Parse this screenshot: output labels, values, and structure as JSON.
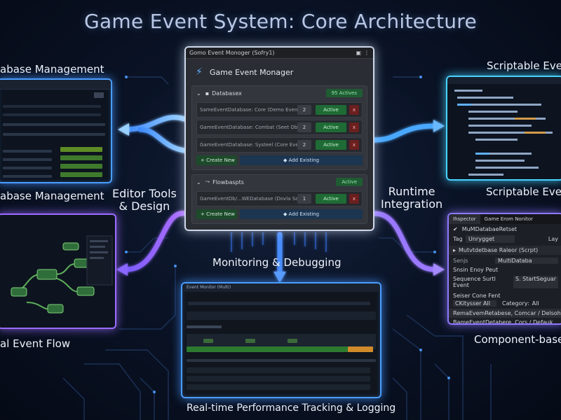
{
  "title": "Game Event System: Core Architecture",
  "labels": {
    "top_left": "abase Management",
    "mid_left": "abase Management",
    "bottom_left": "al Event Flow",
    "top_right": "Scriptable Event",
    "mid_right": "Scriptable Event",
    "bottom_right": "Component-based",
    "editor_tools": "Editor Tools\n& Design",
    "runtime": "Runtime\nIntegration",
    "monitoring": "Monitoring & Debugging",
    "performance": "Real-time Performance Tracking & Logging"
  },
  "window": {
    "titlebar": "Gomo Event Monoger (Sofry1)",
    "heading": "Game Event Monager",
    "section1": {
      "title": "Databasex",
      "badge": "95 Actives",
      "rows": [
        {
          "text": "SameEventDatabase: Core (Demo Event Deat...",
          "num": "2",
          "state": "Active"
        },
        {
          "text": "GameEventDatabase: Combat (Seet Ob/...",
          "num": "2",
          "state": "Active"
        },
        {
          "text": "GameEventDatabase: Systeel (Core Event De...",
          "num": "2",
          "state": "Active"
        }
      ],
      "create": "Create New",
      "add": "Add Existing"
    },
    "section2": {
      "title": "Flowbaspts",
      "badge": "Active",
      "rows": [
        {
          "text": "GameEventDb/...WEDatabase (Dovla Saue 11 D",
          "num": "1",
          "state": "Active"
        }
      ],
      "create": "Create New",
      "add": "Add Existing"
    }
  },
  "inspector": {
    "tab1": "Ihspector",
    "tab2": "Game Erom Nonitor",
    "object": "MuMDatabaeRetset",
    "tag_label": "Tag",
    "tag_value": "Unrygget",
    "layer_label": "Lay",
    "component": "Mutvtdetbase Raleor (Scrpt)",
    "script_label": "Senjs",
    "script_value": "MultiDataba",
    "event_label": "Snsin Enoy Peut",
    "sequence": "Sequence Surtl Event",
    "start_seq": "S. StartSeguar",
    "select_label": "Seiser Cone Fent",
    "dropdown": "CKitysser  All",
    "category_label": "Category:",
    "category_value": "All",
    "list1": "RemaEvemRetabese, Comcar / Delsoh",
    "list2": "BameEventDetabere, Cors / Defauk"
  },
  "monitor": {
    "title": "Event Monitor (Multi)"
  }
}
